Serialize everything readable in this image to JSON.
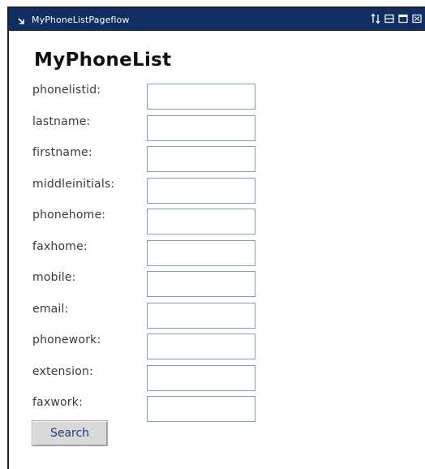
{
  "portlet": {
    "title": "MyPhoneListPageflow"
  },
  "form": {
    "heading": "MyPhoneList",
    "fields": [
      {
        "label": "phonelistid:",
        "value": ""
      },
      {
        "label": "lastname:",
        "value": ""
      },
      {
        "label": "firstname:",
        "value": ""
      },
      {
        "label": "middleinitials:",
        "value": ""
      },
      {
        "label": "phonehome:",
        "value": ""
      },
      {
        "label": "faxhome:",
        "value": ""
      },
      {
        "label": "mobile:",
        "value": ""
      },
      {
        "label": "email:",
        "value": ""
      },
      {
        "label": "phonework:",
        "value": ""
      },
      {
        "label": "extension:",
        "value": ""
      },
      {
        "label": "faxwork:",
        "value": ""
      }
    ],
    "search_label": "Search"
  },
  "colors": {
    "titlebar_bg": "#0f2f63",
    "input_border": "#7f9db9",
    "button_text": "#1e3a78"
  },
  "icons": [
    "minimize-arrow-icon",
    "move-updown-icon",
    "restore-icon",
    "maximize-icon",
    "close-icon"
  ]
}
